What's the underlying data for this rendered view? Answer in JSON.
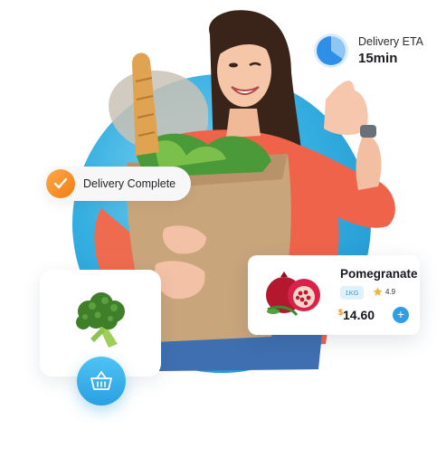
{
  "eta_card": {
    "label": "Delivery ETA",
    "value": "15min",
    "icon": "timer-pie-icon"
  },
  "delivery_status": {
    "label": "Delivery Complete",
    "icon": "check-circle-icon"
  },
  "product": {
    "name": "Pomegranate",
    "unit": "1KG",
    "rating": "4.9",
    "currency": "$",
    "price": "14.60",
    "add_label": "+",
    "image": "pomegranate-image",
    "rating_icon": "star-icon"
  },
  "featured_item": {
    "image": "broccoli-image"
  },
  "cart": {
    "icon": "basket-icon"
  },
  "colors": {
    "accent_blue": "#2f9ee5",
    "accent_orange": "#f07c12",
    "backdrop": "#35aee0"
  }
}
